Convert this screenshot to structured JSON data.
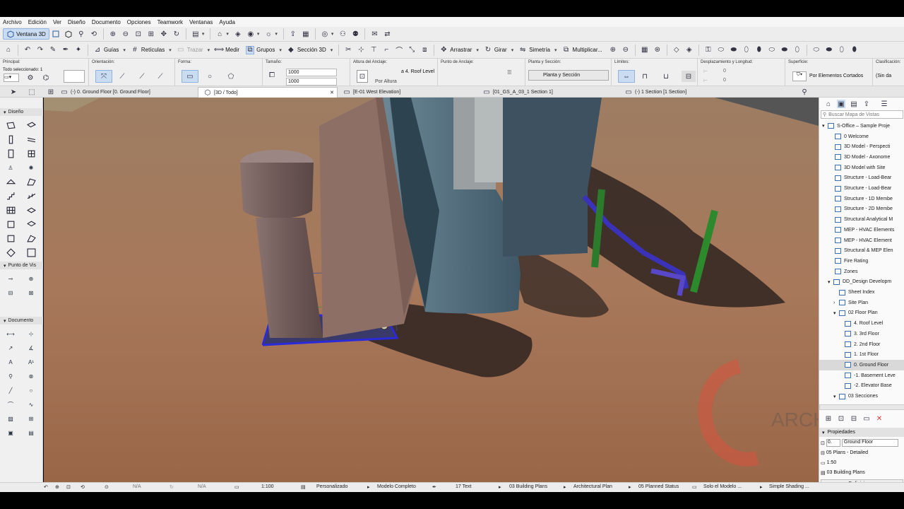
{
  "menu": [
    "Archivo",
    "Edición",
    "Ver",
    "Diseño",
    "Documento",
    "Opciones",
    "Teamwork",
    "Ventanas",
    "Ayuda"
  ],
  "toolbar1": {
    "window_3d_label": "Ventana 3D"
  },
  "toolbar2": {
    "guides": "Guías",
    "grids": "Retículas",
    "trace": "Trazar",
    "measure": "Medir",
    "groups": "Grupos",
    "section3d": "Sección 3D",
    "drag": "Arrastrar",
    "rotate": "Girar",
    "mirror": "Simetría",
    "multiply": "Multiplicar..."
  },
  "infobox": {
    "principal_title": "Principal:",
    "selected_text": "Todo seleccionado: 1",
    "orientation_title": "Orientación:",
    "shape_title": "Forma:",
    "size_title": "Tamaño:",
    "size_a": "1000",
    "size_b": "1000",
    "anchor_height_title": "Altura del Anclaje:",
    "anchor_level": "a 4. Roof Level",
    "by_height": "Por Altura",
    "anchor_point_title": "Punto de Anclaje:",
    "plan_section_title": "Planta y Sección:",
    "plan_section_value": "Planta y Sección",
    "limits_title": "Límites:",
    "offset_title": "Desplazamiento y Longitud:",
    "offset_a": "0",
    "offset_b": "0",
    "surface_title": "Superficie:",
    "surface_value": "Por Elementos Cortados",
    "class_title": "Clasificación:",
    "class_value": "(Sin da"
  },
  "tabs": [
    {
      "label": "(-) 0. Ground Floor [0. Ground Floor]"
    },
    {
      "label": "[3D / Todo]"
    },
    {
      "label": "[E-01 West Elevation]"
    },
    {
      "label": "[01_GS_A_03_1 Section 1]"
    },
    {
      "label": "(-) 1 Section [1 Section]"
    }
  ],
  "toolbox": {
    "design": "Diseño",
    "viewpoint": "Punto de Vis",
    "document": "Documento"
  },
  "navigator": {
    "search_placeholder": "Buscar Mapa de Vistas",
    "items": [
      {
        "label": "S-Office – Sample Proje"
      },
      {
        "label": "0 Welcome"
      },
      {
        "label": "3D Model - Perspecti"
      },
      {
        "label": "3D Model - Axonome"
      },
      {
        "label": "3D Model with Site"
      },
      {
        "label": "Structure - Load-Bear"
      },
      {
        "label": "Structure - Load-Bear"
      },
      {
        "label": "Structure - 1D Membe"
      },
      {
        "label": "Structure - 2D Membe"
      },
      {
        "label": "Structural Analytical M"
      },
      {
        "label": "MEP - HVAC Elements"
      },
      {
        "label": "MEP - HVAC Element"
      },
      {
        "label": "Structural & MEP Elen"
      },
      {
        "label": "Fire Rating"
      },
      {
        "label": "Zones"
      },
      {
        "label": "DD_Design Developm"
      },
      {
        "label": "Sheet Index"
      },
      {
        "label": "Site Plan"
      },
      {
        "label": "02 Floor Plan"
      },
      {
        "label": "4. Roof Level"
      },
      {
        "label": "3. 3rd Floor"
      },
      {
        "label": "2. 2nd Floor"
      },
      {
        "label": "1. 1st Floor"
      },
      {
        "label": "0. Ground Floor"
      },
      {
        "label": "-1. Basement Leve"
      },
      {
        "label": "-2. Elevator Base"
      },
      {
        "label": "03 Secciones"
      }
    ],
    "properties_title": "Propiedades",
    "prop_id": "0.",
    "prop_name": "Ground Floor",
    "prop_template": "05 Plans - Detailed",
    "prop_scale": "1:50",
    "prop_layer": "03 Building Plans",
    "definitions": "Definiciones"
  },
  "statusbar": {
    "na1": "N/A",
    "na2": "N/A",
    "scale": "1:100",
    "custom": "Personalizado",
    "model": "Modelo Completo",
    "text": "17 Text",
    "layer": "03 Building Plans",
    "arch": "Architectural Plan",
    "status": "05 Planned Status",
    "only": "Solo el Modelo ...",
    "shading": "Simple Shading ..."
  },
  "watermark": "ARCHI"
}
